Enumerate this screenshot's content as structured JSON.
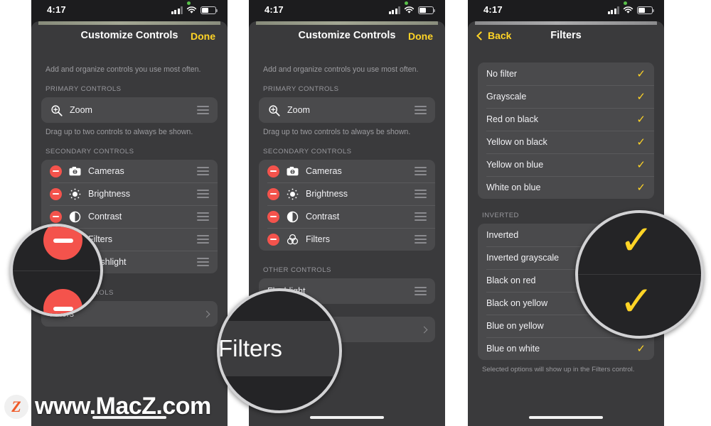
{
  "meta": {
    "accent_yellow": "#ffd426",
    "remove_red": "#f4534c",
    "sheet_bg": "#3a3a3c",
    "group_bg": "#4a4a4c"
  },
  "status_bar": {
    "time": "4:17",
    "cell_icon": "cellular-bars-icon",
    "wifi_icon": "wifi-icon",
    "battery_icon": "battery-icon",
    "recording_dot": "green-status-dot"
  },
  "phone1": {
    "nav": {
      "title": "Customize Controls",
      "done_label": "Done"
    },
    "hint_top": "Add and organize controls you use most often.",
    "primary_header": "PRIMARY CONTROLS",
    "primary_items": [
      {
        "label": "Zoom",
        "icon": "zoom-in-icon",
        "handle": "drag-handle-icon"
      }
    ],
    "hint_primary": "Drag up to two controls to always be shown.",
    "secondary_header": "SECONDARY CONTROLS",
    "secondary_items": [
      {
        "label": "Cameras",
        "icon": "camera-icon"
      },
      {
        "label": "Brightness",
        "icon": "brightness-icon"
      },
      {
        "label": "Contrast",
        "icon": "contrast-icon"
      },
      {
        "label": "Filters",
        "icon": "filters-icon"
      },
      {
        "label": "Flashlight",
        "icon": "flashlight-icon"
      }
    ],
    "other_header": "OTHER CONTROLS",
    "other_items": [
      {
        "label": "Filters",
        "chevron": "chevron-right-icon"
      }
    ],
    "loupe": {
      "name": "remove-buttons-magnifier",
      "content": [
        "remove-button",
        "remove-button"
      ]
    }
  },
  "phone2": {
    "nav": {
      "title": "Customize Controls",
      "done_label": "Done"
    },
    "hint_top": "Add and organize controls you use most often.",
    "primary_header": "PRIMARY CONTROLS",
    "primary_items": [
      {
        "label": "Zoom",
        "icon": "zoom-in-icon",
        "handle": "drag-handle-icon"
      }
    ],
    "hint_primary": "Drag up to two controls to always be shown.",
    "secondary_header": "SECONDARY CONTROLS",
    "secondary_items": [
      {
        "label": "Cameras",
        "icon": "camera-icon"
      },
      {
        "label": "Brightness",
        "icon": "brightness-icon"
      },
      {
        "label": "Contrast",
        "icon": "contrast-icon"
      },
      {
        "label": "Filters",
        "icon": "filters-icon"
      }
    ],
    "other_header": "OTHER CONTROLS",
    "other_items": [
      {
        "label": "Flashlight",
        "handle": "drag-handle-icon"
      },
      {
        "label": "Filters",
        "chevron": "chevron-right-icon"
      }
    ],
    "loupe": {
      "name": "filters-row-magnifier",
      "label": "Filters"
    }
  },
  "phone3": {
    "nav": {
      "back_label": "Back",
      "title": "Filters"
    },
    "group1": [
      {
        "label": "No filter",
        "checked": true
      },
      {
        "label": "Grayscale",
        "checked": true
      },
      {
        "label": "Red on black",
        "checked": true
      },
      {
        "label": "Yellow on black",
        "checked": true
      },
      {
        "label": "Yellow on blue",
        "checked": true
      },
      {
        "label": "White on blue",
        "checked": true
      }
    ],
    "inverted_header": "INVERTED",
    "group2": [
      {
        "label": "Inverted",
        "checked": true
      },
      {
        "label": "Inverted grayscale",
        "checked": true
      },
      {
        "label": "Black on red",
        "checked": true
      },
      {
        "label": "Black on yellow",
        "checked": false
      },
      {
        "label": "Blue on yellow",
        "checked": true
      },
      {
        "label": "Blue on white",
        "checked": true
      }
    ],
    "footnote": "Selected options will show up in the Filters control.",
    "loupe": {
      "name": "checkmarks-magnifier",
      "content": [
        "checkmark-icon",
        "checkmark-icon"
      ]
    }
  },
  "watermark": {
    "badge_letter": "Z",
    "text": "www.MacZ.com"
  }
}
